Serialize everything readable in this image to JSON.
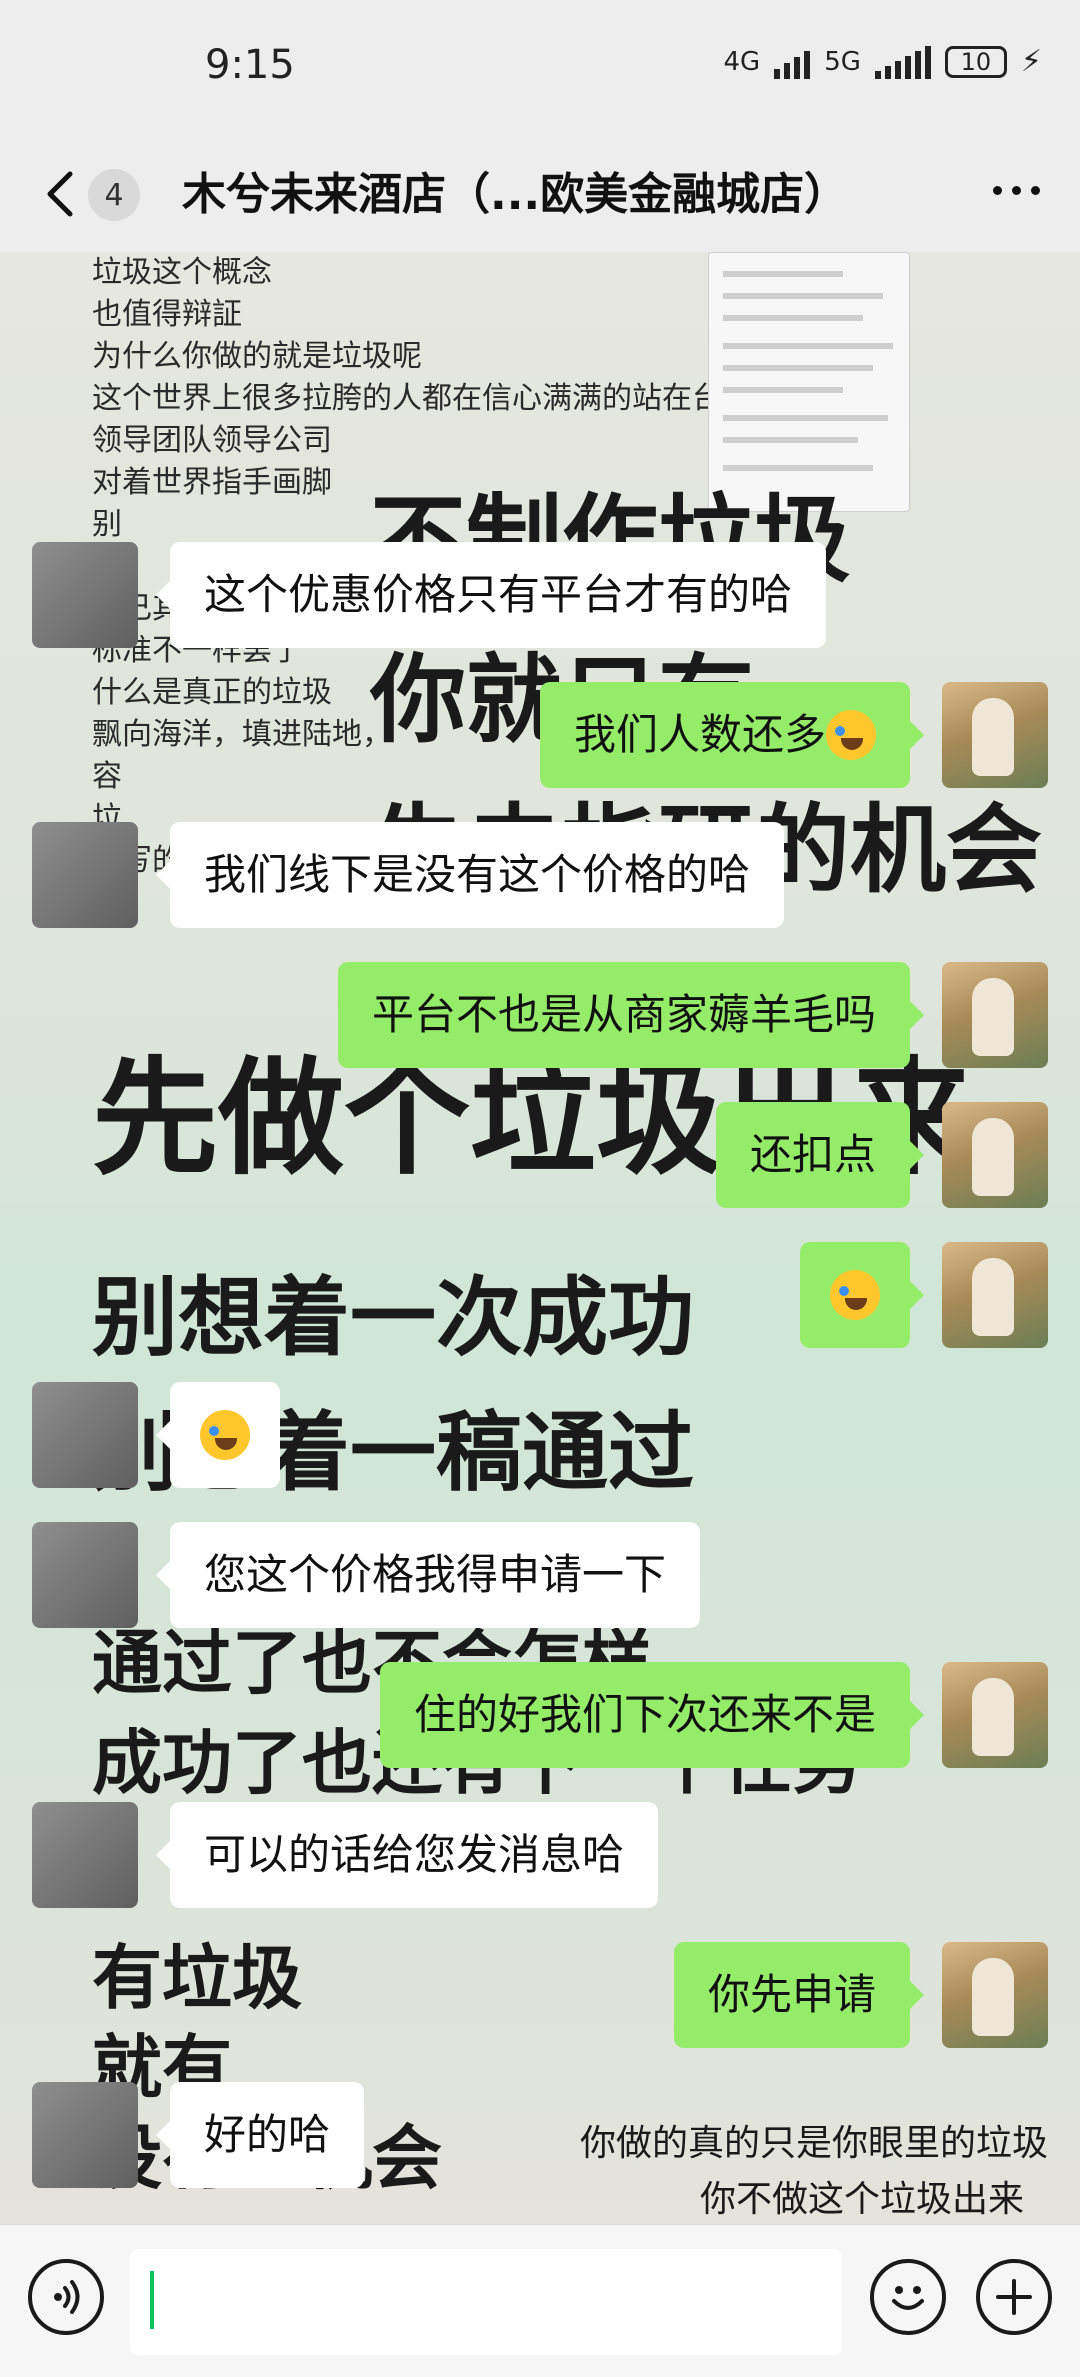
{
  "status_bar": {
    "time": "9:15",
    "net1": "4G",
    "net2": "5G",
    "battery": "10"
  },
  "nav": {
    "badge": "4",
    "title": "木兮未来酒店（...欧美金融城店）"
  },
  "wallpaper": {
    "poem": [
      "垃圾这个概念",
      "也值得辩証",
      "为什么你做的就是垃圾呢",
      "这个世界上很多拉胯的人都在信心满满的站在台上",
      "领导团队领导公司",
      "对着世界指手画脚",
      "别",
      "拉",
      "自己其实是拉胯",
      "标准不一样罢了",
      "什么是真正的垃圾",
      "飘向海洋，填进陆地，",
      "容",
      "垃",
      "你写的垃圾文档 已经很环保了"
    ],
    "big": [
      "不制作垃圾",
      "你就只有",
      "失去指研的机会",
      "先做个垃圾出来",
      "别想着一次成功",
      "别想着一稿通过",
      "通过了也不会怎样",
      "成功了也还有下一个任务",
      "有垃圾",
      "就有",
      "没有的机会"
    ],
    "small": [
      "你做的真的只是你眼里的垃圾",
      "你不做这个垃圾出来"
    ]
  },
  "messages": [
    {
      "side": "left",
      "text": "这个优惠价格只有平台才有的哈"
    },
    {
      "side": "right",
      "text": "我们人数还多",
      "emoji": "tears-of-joy-emoji"
    },
    {
      "side": "left",
      "text": "我们线下是没有这个价格的哈"
    },
    {
      "side": "right",
      "text": "平台不也是从商家薅羊毛吗"
    },
    {
      "side": "right",
      "text": "还扣点"
    },
    {
      "side": "right",
      "text": "",
      "emoji": "tears-of-joy-emoji"
    },
    {
      "side": "left",
      "text": "",
      "emoji": "tears-of-joy-emoji"
    },
    {
      "side": "left",
      "text": "您这个价格我得申请一下"
    },
    {
      "side": "right",
      "text": "住的好我们下次还来不是"
    },
    {
      "side": "left",
      "text": "可以的话给您发消息哈"
    },
    {
      "side": "right",
      "text": "你先申请"
    },
    {
      "side": "left",
      "text": "好的哈"
    }
  ],
  "input": {
    "value": "",
    "placeholder": ""
  },
  "colors": {
    "sent_bubble": "#95ec69",
    "received_bubble": "#ffffff",
    "caret": "#07c160"
  }
}
